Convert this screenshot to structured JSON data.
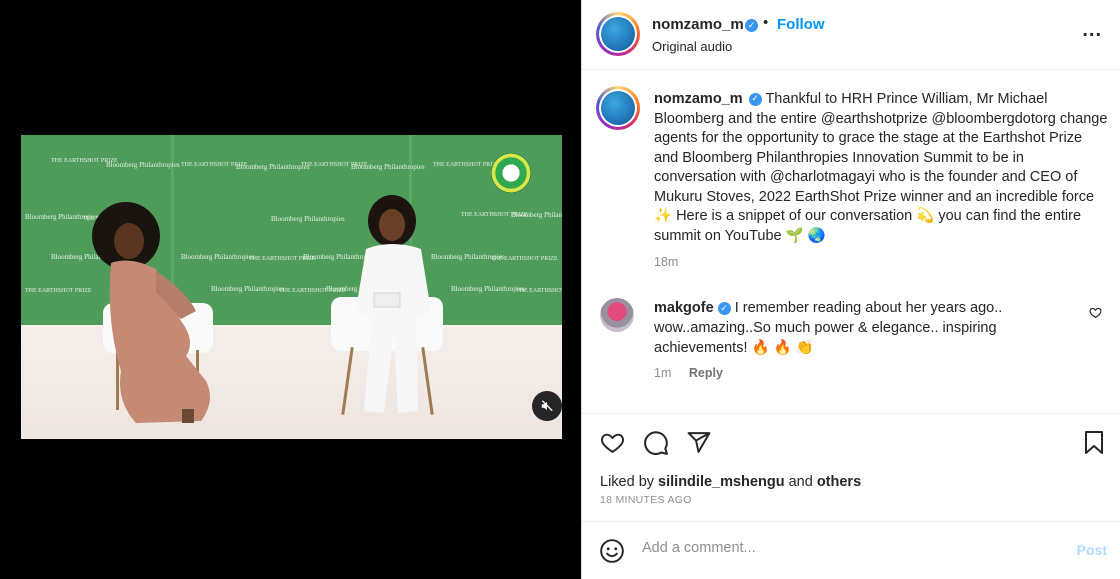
{
  "media": {
    "backdrop_texts": [
      "THE EARTHSHOT PRIZE",
      "Bloomberg Philanthropies"
    ],
    "mute_icon": "muted-speaker-icon",
    "colors": {
      "backdrop": "#4f9c5a",
      "stage": "#f3ece7"
    }
  },
  "header": {
    "username": "nomzamo_m",
    "dot": "•",
    "follow_label": "Follow",
    "subtitle": "Original audio",
    "more_label": "..."
  },
  "caption": {
    "username": "nomzamo_m",
    "text": "Thankful to HRH Prince William, Mr Michael Bloomberg and the entire @earthshotprize @bloombergdotorg change agents for the opportunity to grace the stage at the Earthshot Prize and Bloomberg Philanthropies Innovation Summit to be in conversation with @charlotmagayi who is the founder and CEO of Mukuru Stoves, 2022 EarthShot Prize winner and an incredible force ✨ Here is a snippet of our conversation 💫 you can find the entire summit on YouTube 🌱 🌏",
    "time": "18m"
  },
  "comment": {
    "username": "makgofe",
    "text": "I remember reading about her years ago.. wow..amazing..So much power & elegance.. inspiring achievements! 🔥 🔥 👏",
    "time": "1m",
    "reply_label": "Reply"
  },
  "actions": {
    "icons": [
      "heart-icon",
      "comment-icon",
      "share-icon",
      "bookmark-icon"
    ]
  },
  "likes": {
    "prefix": "Liked by",
    "user": "silindile_mshengu",
    "and": "and",
    "others": "others",
    "time": "18 MINUTES AGO"
  },
  "add_comment": {
    "placeholder": "Add a comment...",
    "post_label": "Post"
  },
  "colors": {
    "accent": "#0095f6",
    "verified": "#3897f0",
    "muted_text": "#8e8e8e",
    "post_disabled": "#b3dbff"
  }
}
